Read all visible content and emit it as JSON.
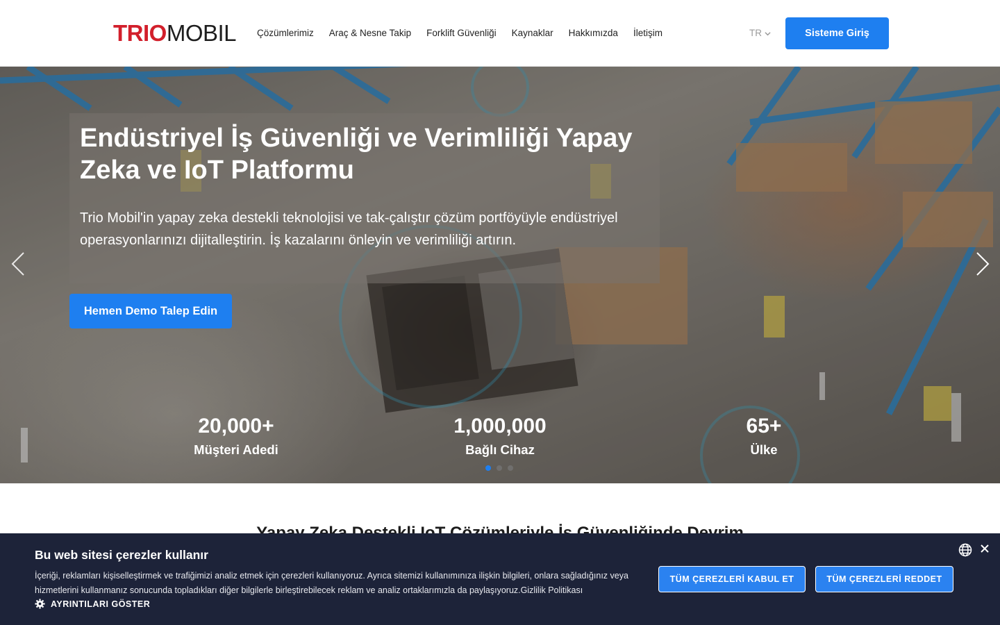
{
  "header": {
    "logo": {
      "part1": "TRIO",
      "part2": "MOBIL"
    },
    "nav": [
      {
        "label": "Çözümlerimiz"
      },
      {
        "label": "Araç & Nesne Takip"
      },
      {
        "label": "Forklift Güvenliği"
      },
      {
        "label": "Kaynaklar"
      },
      {
        "label": "Hakkımızda"
      },
      {
        "label": "İletişim"
      }
    ],
    "language": "TR",
    "login_label": "Sisteme Giriş"
  },
  "hero": {
    "title": "Endüstriyel İş Güvenliği ve Verimliliği Yapay Zeka ve IoT Platformu",
    "subtitle": "Trio Mobil'in yapay zeka destekli teknolojisi ve tak-çalıştır çözüm portföyüyle endüstriyel operasyonlarınızı dijitalleştirin. İş kazalarını önleyin ve verimliliği artırın.",
    "cta_label": "Hemen Demo Talep Edin",
    "stats": [
      {
        "value": "20,000+",
        "label": "Müşteri Adedi"
      },
      {
        "value": "1,000,000",
        "label": "Bağlı Cihaz"
      },
      {
        "value": "65+",
        "label": "Ülke"
      }
    ],
    "active_slide": 1,
    "slide_count": 3
  },
  "section": {
    "title": "Yapay Zeka Destekli IoT Çözümleriyle İş Güvenliğinde Devrim"
  },
  "cookie_banner": {
    "title": "Bu web sitesi çerezler kullanır",
    "text": "İçeriği, reklamları kişiselleştirmek ve trafiğimizi analiz etmek için çerezleri kullanıyoruz. Ayrıca sitemizi kullanımınıza ilişkin bilgileri, onlara sağladığınız veya hizmetlerini kullanmanız sonucunda topladıkları diğer bilgilerle birleştirebilecek reklam ve analiz ortaklarımızla da paylaşıyoruz.Gizlilik Politikası",
    "details_label": "AYRINTILARI GÖSTER",
    "accept_label": "TÜM ÇEREZLERİ KABUL ET",
    "reject_label": "TÜM ÇEREZLERİ REDDET"
  },
  "colors": {
    "brand_red": "#d21f2b",
    "accent_blue": "#1e7ff0",
    "cookie_bg": "#1d2339"
  }
}
